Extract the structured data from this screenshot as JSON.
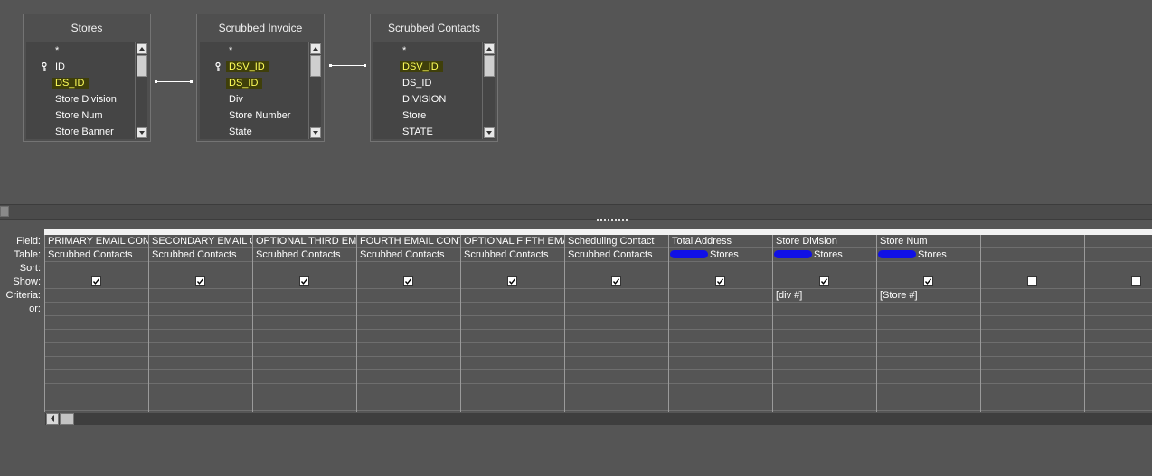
{
  "tables": [
    {
      "title": "Stores",
      "fields": [
        {
          "label": "*",
          "key": false,
          "highlight": false
        },
        {
          "label": "ID",
          "key": true,
          "highlight": false
        },
        {
          "label": "DS_ID",
          "key": false,
          "highlight": true
        },
        {
          "label": "Store Division",
          "key": false,
          "highlight": false
        },
        {
          "label": "Store Num",
          "key": false,
          "highlight": false
        },
        {
          "label": "Store Banner",
          "key": false,
          "highlight": false
        }
      ]
    },
    {
      "title": "Scrubbed        Invoice",
      "fields": [
        {
          "label": "*",
          "key": false,
          "highlight": false
        },
        {
          "label": "DSV_ID",
          "key": true,
          "highlight": true
        },
        {
          "label": "DS_ID",
          "key": false,
          "highlight": true
        },
        {
          "label": "Div",
          "key": false,
          "highlight": false
        },
        {
          "label": "Store Number",
          "key": false,
          "highlight": false
        },
        {
          "label": "State",
          "key": false,
          "highlight": false
        }
      ]
    },
    {
      "title": "Scrubbed Contacts",
      "fields": [
        {
          "label": "*",
          "key": false,
          "highlight": false
        },
        {
          "label": "DSV_ID",
          "key": false,
          "highlight": true
        },
        {
          "label": "DS_ID",
          "key": false,
          "highlight": false
        },
        {
          "label": "DIVISION",
          "key": false,
          "highlight": false
        },
        {
          "label": "Store",
          "key": false,
          "highlight": false
        },
        {
          "label": "STATE",
          "key": false,
          "highlight": false
        }
      ]
    }
  ],
  "row_labels": [
    "Field:",
    "Table:",
    "Sort:",
    "Show:",
    "Criteria:",
    "or:"
  ],
  "columns": [
    {
      "field": "PRIMARY EMAIL CONTACT",
      "table": "Scrubbed Contacts",
      "redacted": false,
      "sort": "",
      "show": true,
      "criteria": "",
      "or": ""
    },
    {
      "field": "SECONDARY EMAIL CONTACT",
      "table": "Scrubbed Contacts",
      "redacted": false,
      "sort": "",
      "show": true,
      "criteria": "",
      "or": ""
    },
    {
      "field": "OPTIONAL THIRD EMAIL",
      "table": "Scrubbed Contacts",
      "redacted": false,
      "sort": "",
      "show": true,
      "criteria": "",
      "or": ""
    },
    {
      "field": "FOURTH EMAIL CONTACT",
      "table": "Scrubbed Contacts",
      "redacted": false,
      "sort": "",
      "show": true,
      "criteria": "",
      "or": ""
    },
    {
      "field": "OPTIONAL FIFTH EMAIL",
      "table": "Scrubbed Contacts",
      "redacted": false,
      "sort": "",
      "show": true,
      "criteria": "",
      "or": ""
    },
    {
      "field": "Scheduling Contact",
      "table": "Scrubbed Contacts",
      "redacted": false,
      "sort": "",
      "show": true,
      "criteria": "",
      "or": ""
    },
    {
      "field": "Total Address",
      "table": "Stores",
      "redacted": true,
      "sort": "",
      "show": true,
      "criteria": "",
      "or": ""
    },
    {
      "field": "Store Division",
      "table": "Stores",
      "redacted": true,
      "sort": "",
      "show": true,
      "criteria": "[div #]",
      "or": ""
    },
    {
      "field": "Store Num",
      "table": "Stores",
      "redacted": true,
      "sort": "",
      "show": true,
      "criteria": "[Store #]",
      "or": ""
    },
    {
      "field": "",
      "table": "",
      "redacted": false,
      "sort": "",
      "show": false,
      "criteria": "",
      "or": ""
    },
    {
      "field": "",
      "table": "",
      "redacted": false,
      "sort": "",
      "show": false,
      "criteria": "",
      "or": ""
    }
  ],
  "colors": {
    "background": "#555555",
    "highlight_text": "#ffff5a",
    "highlight_bg": "#3f3f0a",
    "redaction": "#1010e6"
  }
}
